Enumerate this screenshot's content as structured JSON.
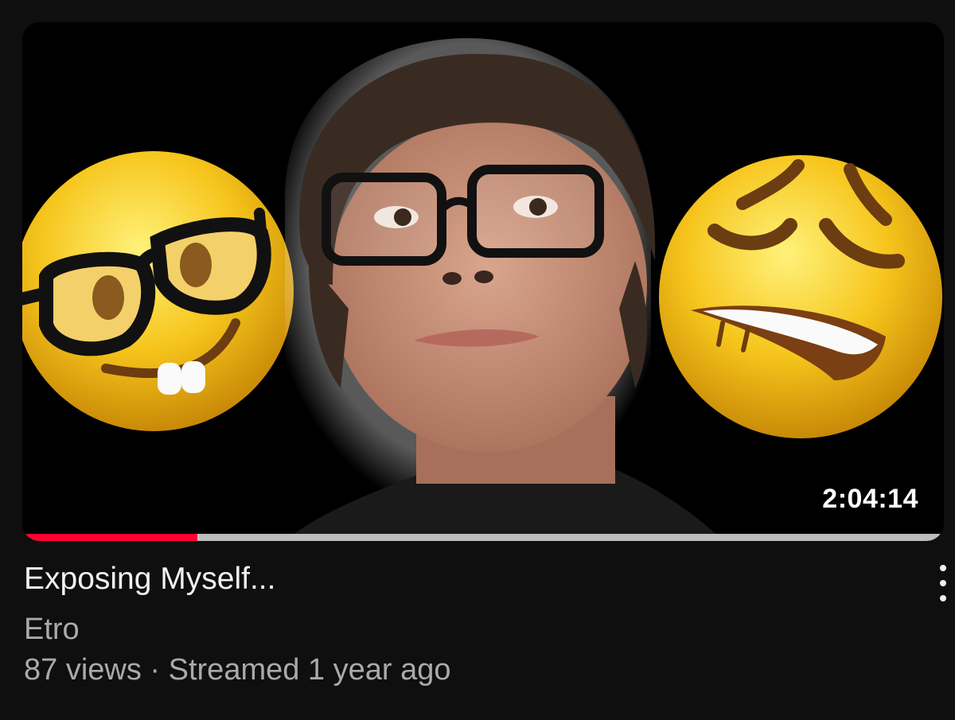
{
  "video": {
    "title": "Exposing Myself...",
    "channel": "Etro",
    "views": "87 views",
    "separator": " · ",
    "streamed": "Streamed 1 year ago",
    "duration": "2:04:14",
    "watched_fraction": 0.19
  },
  "thumbnail": {
    "left_icon": "nerd-face-emoji-icon",
    "right_icon": "weary-face-emoji-icon",
    "subject": "person-with-glasses",
    "accent_progress_color": "#ff0033"
  },
  "menu": {
    "icon": "more-vertical-icon"
  }
}
